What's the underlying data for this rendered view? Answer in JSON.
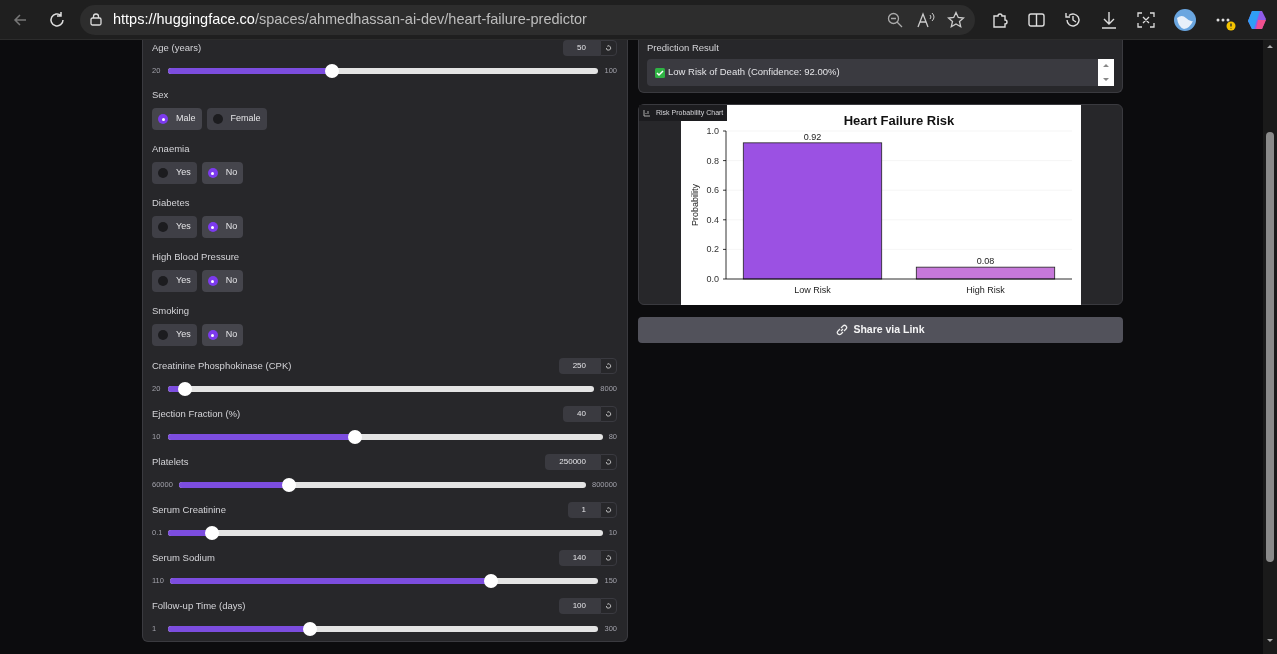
{
  "browser": {
    "url_host": "https://huggingface.co",
    "url_path": "/spaces/ahmedhassan-ai-dev/heart-failure-predictor"
  },
  "inputs": [
    {
      "kind": "slider",
      "label": "Age (years)",
      "value": "50",
      "min": "20",
      "max": "100",
      "level": 0.38
    },
    {
      "kind": "radio",
      "label": "Sex",
      "options": [
        {
          "label": "Male",
          "selected": true
        },
        {
          "label": "Female",
          "selected": false
        }
      ]
    },
    {
      "kind": "radio",
      "label": "Anaemia",
      "options": [
        {
          "label": "Yes",
          "selected": false
        },
        {
          "label": "No",
          "selected": true
        }
      ]
    },
    {
      "kind": "radio",
      "label": "Diabetes",
      "options": [
        {
          "label": "Yes",
          "selected": false
        },
        {
          "label": "No",
          "selected": true
        }
      ]
    },
    {
      "kind": "radio",
      "label": "High Blood Pressure",
      "options": [
        {
          "label": "Yes",
          "selected": false
        },
        {
          "label": "No",
          "selected": true
        }
      ]
    },
    {
      "kind": "radio",
      "label": "Smoking",
      "options": [
        {
          "label": "Yes",
          "selected": false
        },
        {
          "label": "No",
          "selected": true
        }
      ]
    },
    {
      "kind": "slider",
      "label": "Creatinine Phosphokinase (CPK)",
      "value": "250",
      "min": "20",
      "max": "8000",
      "level": 0.04
    },
    {
      "kind": "slider",
      "label": "Ejection Fraction (%)",
      "value": "40",
      "min": "10",
      "max": "80",
      "level": 0.43
    },
    {
      "kind": "slider",
      "label": "Platelets",
      "value": "250000",
      "min": "60000",
      "max": "800000",
      "level": 0.27
    },
    {
      "kind": "slider",
      "label": "Serum Creatinine",
      "value": "1",
      "min": "0.1",
      "max": "10",
      "level": 0.1
    },
    {
      "kind": "slider",
      "label": "Serum Sodium",
      "value": "140",
      "min": "110",
      "max": "150",
      "level": 0.75
    },
    {
      "kind": "slider",
      "label": "Follow-up Time (days)",
      "value": "100",
      "min": "1",
      "max": "300",
      "level": 0.33
    }
  ],
  "result": {
    "label": "Prediction Result",
    "text": "Low Risk of Death (Confidence: 92.00%)"
  },
  "chart_panel": {
    "label": "Risk Probability Chart",
    "chart_data": {
      "type": "bar",
      "title": "Heart Failure Risk",
      "ylabel": "Probability",
      "categories": [
        "Low Risk",
        "High Risk"
      ],
      "grid": true,
      "values": [
        0.92,
        0.08
      ],
      "colors": [
        "#9b51e3",
        "#c678da"
      ],
      "ylim": [
        0,
        1
      ],
      "yticks": [
        {
          "value": 0,
          "label": "0.0"
        },
        {
          "value": 0.2,
          "label": "0.2"
        },
        {
          "value": 0.4,
          "label": "0.4"
        },
        {
          "value": 0.6,
          "label": "0.6"
        },
        {
          "value": 0.8,
          "label": "0.8"
        },
        {
          "value": 1,
          "label": "1.0"
        }
      ],
      "data_labels": true
    }
  },
  "share_button": "Share via Link"
}
